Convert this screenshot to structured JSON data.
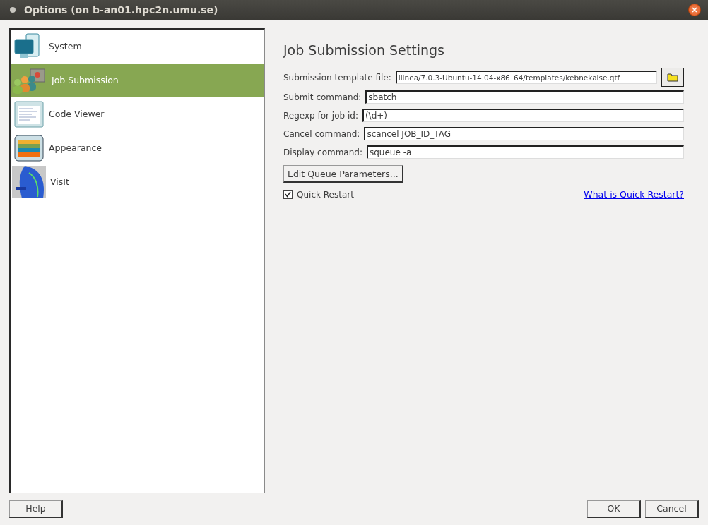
{
  "window": {
    "title": "Options (on b-an01.hpc2n.umu.se)"
  },
  "sidebar": {
    "items": [
      {
        "label": "System",
        "selected": false
      },
      {
        "label": "Job Submission",
        "selected": true
      },
      {
        "label": "Code Viewer",
        "selected": false
      },
      {
        "label": "Appearance",
        "selected": false
      },
      {
        "label": "VisIt",
        "selected": false
      }
    ]
  },
  "panel": {
    "heading": "Job Submission Settings",
    "fields": [
      {
        "kind": "file",
        "label": "Submission template file:",
        "value": "llinea/7.0.3-Ubuntu-14.04-x86_64/templates/kebnekaise.qtf"
      },
      {
        "kind": "text",
        "label": "Submit command:",
        "value": "sbatch"
      },
      {
        "kind": "text",
        "label": "Regexp for job id:",
        "value": "(\\d+)"
      },
      {
        "kind": "text",
        "label": "Cancel command:",
        "value": "scancel JOB_ID_TAG"
      },
      {
        "kind": "text",
        "label": "Display command:",
        "value": "squeue -a"
      }
    ],
    "edit_button": "Edit Queue Parameters...",
    "quick_restart": {
      "label": "Quick Restart",
      "checked": true
    },
    "help_link": "What is Quick Restart?"
  },
  "buttons": {
    "help": "Help",
    "ok": "OK",
    "cancel": "Cancel"
  }
}
